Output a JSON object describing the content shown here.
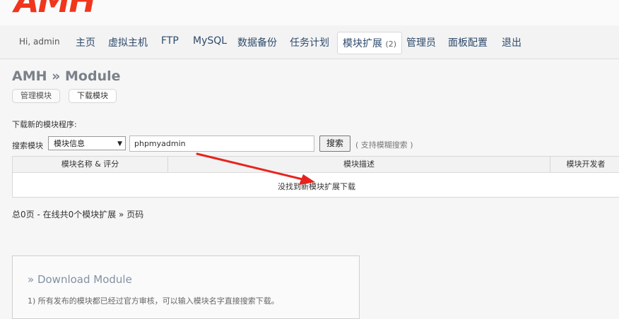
{
  "logo": {
    "text": "AMH"
  },
  "nav": {
    "greeting": "Hi, admin",
    "items": [
      {
        "label": "主页"
      },
      {
        "label": "虚拟主机"
      },
      {
        "label": "FTP"
      },
      {
        "label": "MySQL"
      },
      {
        "label": "数据备份"
      },
      {
        "label": "任务计划"
      },
      {
        "label": "模块扩展",
        "count": "(2)",
        "active": true
      },
      {
        "label": "管理员"
      },
      {
        "label": "面板配置"
      },
      {
        "label": "退出"
      }
    ]
  },
  "page": {
    "title": "AMH » Module",
    "tabs": [
      {
        "label": "管理模块"
      },
      {
        "label": "下载模块",
        "active": true
      }
    ]
  },
  "search": {
    "section_label": "下载新的模块程序:",
    "label": "搜索模块",
    "select_value": "模块信息",
    "input_value": "phpmyadmin",
    "button_label": "搜索",
    "hint": "( 支持模糊搜索 )"
  },
  "table": {
    "headers": [
      "模块名称 & 评分",
      "模块描述",
      "模块开发者"
    ],
    "empty_message": "没找到新模块扩展下载"
  },
  "pager": {
    "text": "总0页 - 在线共0个模块扩展 » 页码"
  },
  "info": {
    "title": "» Download Module",
    "lines": [
      "1) 所有发布的模块都已经过官方审核，可以输入模块名字直接搜索下载。"
    ]
  },
  "colors": {
    "logo": "#f0351c",
    "arrow": "#e8231e",
    "nav_text": "#2d4a6b"
  }
}
